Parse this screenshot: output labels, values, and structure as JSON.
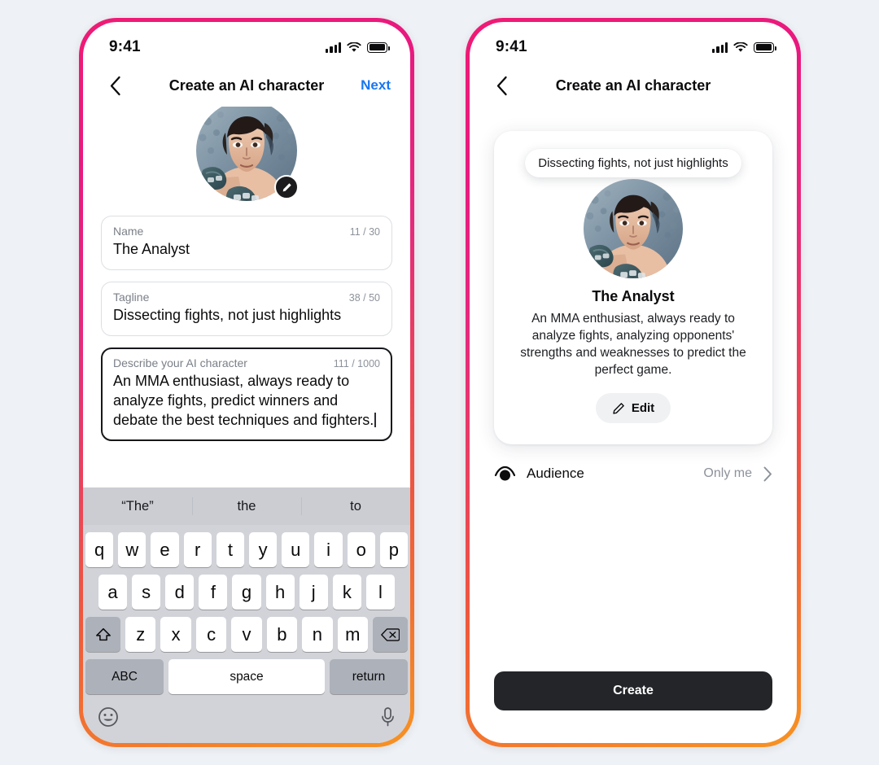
{
  "background_color": "#eef1f5",
  "frame_gradient": {
    "from": "#ef1b74",
    "to": "#f79322"
  },
  "status_bar": {
    "time": "9:41",
    "cellular_icon": "signal-bars-icon",
    "wifi_icon": "wifi-icon",
    "battery_icon": "battery-full-icon"
  },
  "left_phone": {
    "nav": {
      "back_icon": "chevron-left-icon",
      "title": "Create an AI character",
      "next_label": "Next",
      "next_color": "#1877f2"
    },
    "avatar": {
      "alt": "ai-character-avatar",
      "edit_icon": "pencil-icon"
    },
    "fields": [
      {
        "key": "name",
        "label": "Name",
        "counter": "11 / 30",
        "value": "The Analyst",
        "focused": false
      },
      {
        "key": "tagline",
        "label": "Tagline",
        "counter": "38 / 50",
        "value": "Dissecting fights, not just highlights",
        "focused": false
      },
      {
        "key": "description",
        "label": "Describe your AI character",
        "counter": "111 / 1000",
        "value": "An MMA enthusiast, always ready to analyze fights, predict winners and debate the best techniques and fighters.",
        "focused": true
      }
    ],
    "keyboard": {
      "suggestions": [
        "“The”",
        "the",
        "to"
      ],
      "row1": [
        "q",
        "w",
        "e",
        "r",
        "t",
        "y",
        "u",
        "i",
        "o",
        "p"
      ],
      "row2": [
        "a",
        "s",
        "d",
        "f",
        "g",
        "h",
        "j",
        "k",
        "l"
      ],
      "row3_letters": [
        "z",
        "x",
        "c",
        "v",
        "b",
        "n",
        "m"
      ],
      "shift_icon": "shift-arrow-icon",
      "backspace_icon": "backspace-icon",
      "abc_label": "ABC",
      "space_label": "space",
      "return_label": "return",
      "emoji_icon": "emoji-smiley-icon",
      "mic_icon": "microphone-icon"
    }
  },
  "right_phone": {
    "nav": {
      "back_icon": "chevron-left-icon",
      "title": "Create an AI character"
    },
    "card": {
      "bubble_text": "Dissecting fights, not just highlights",
      "avatar_alt": "ai-character-avatar",
      "name": "The Analyst",
      "description": "An MMA enthusiast, always ready to analyze fights, analyzing opponents' strengths and weaknesses to predict the perfect game.",
      "edit_label": "Edit",
      "edit_icon": "pencil-icon"
    },
    "audience": {
      "icon": "audience-eye-icon",
      "label": "Audience",
      "value": "Only me",
      "chevron_icon": "chevron-right-icon"
    },
    "create_label": "Create",
    "create_color": "#232528"
  }
}
